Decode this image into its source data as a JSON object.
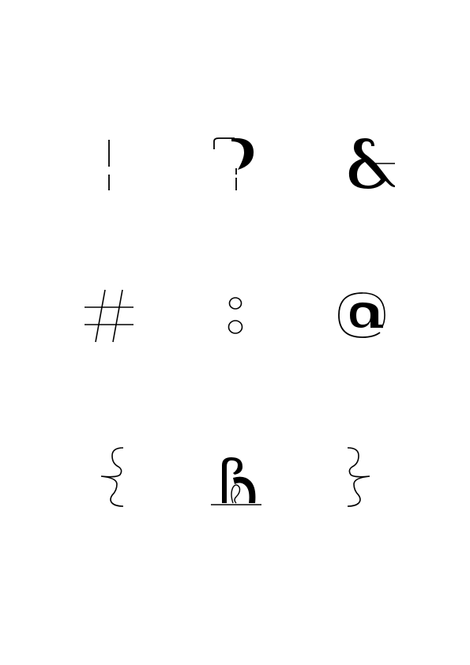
{
  "specimen": {
    "ink_color": "#000000",
    "background_color": "#ffffff",
    "glyphs": [
      {
        "char": "!",
        "name": "exclamation-mark"
      },
      {
        "char": "?",
        "name": "question-mark"
      },
      {
        "char": "&",
        "name": "ampersand"
      },
      {
        "char": "#",
        "name": "number-sign"
      },
      {
        "char": ":",
        "name": "colon"
      },
      {
        "char": "@",
        "name": "at-sign"
      },
      {
        "char": "{",
        "name": "left-curly-brace"
      },
      {
        "char": "",
        "name": "ornamental-ligature"
      },
      {
        "char": "}",
        "name": "right-curly-brace"
      }
    ]
  }
}
